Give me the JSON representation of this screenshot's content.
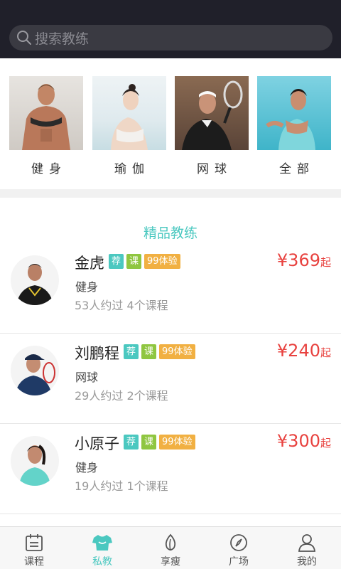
{
  "search": {
    "placeholder": "搜索教练"
  },
  "categories": [
    {
      "label": "健身",
      "image": "fitness-photo"
    },
    {
      "label": "瑜伽",
      "image": "yoga-photo"
    },
    {
      "label": "网球",
      "image": "tennis-photo"
    },
    {
      "label": "全部",
      "image": "all-photo"
    }
  ],
  "section": {
    "title": "精品教练"
  },
  "coaches": [
    {
      "name": "金虎",
      "tags": [
        "荐",
        "课",
        "99体验"
      ],
      "sport": "健身",
      "stats": "53人约过  4个课程",
      "price": "¥369",
      "price_suffix": "起"
    },
    {
      "name": "刘鹏程",
      "tags": [
        "荐",
        "课",
        "99体验"
      ],
      "sport": "网球",
      "stats": "29人约过  2个课程",
      "price": "¥240",
      "price_suffix": "起"
    },
    {
      "name": "小原子",
      "tags": [
        "荐",
        "课",
        "99体验"
      ],
      "sport": "健身",
      "stats": "19人约过  1个课程",
      "price": "¥300",
      "price_suffix": "起"
    }
  ],
  "tabs": [
    {
      "label": "课程",
      "icon": "calendar-icon"
    },
    {
      "label": "私教",
      "icon": "shirt-icon",
      "active": true
    },
    {
      "label": "享瘦",
      "icon": "leaf-icon"
    },
    {
      "label": "广场",
      "icon": "compass-icon"
    },
    {
      "label": "我的",
      "icon": "user-icon"
    }
  ],
  "colors": {
    "accent": "#4bc8c0",
    "price": "#e8423f",
    "header": "#20202a",
    "tag_recommend": "#4bc8c0",
    "tag_course": "#8fc640",
    "tag_trial": "#f1b042"
  }
}
